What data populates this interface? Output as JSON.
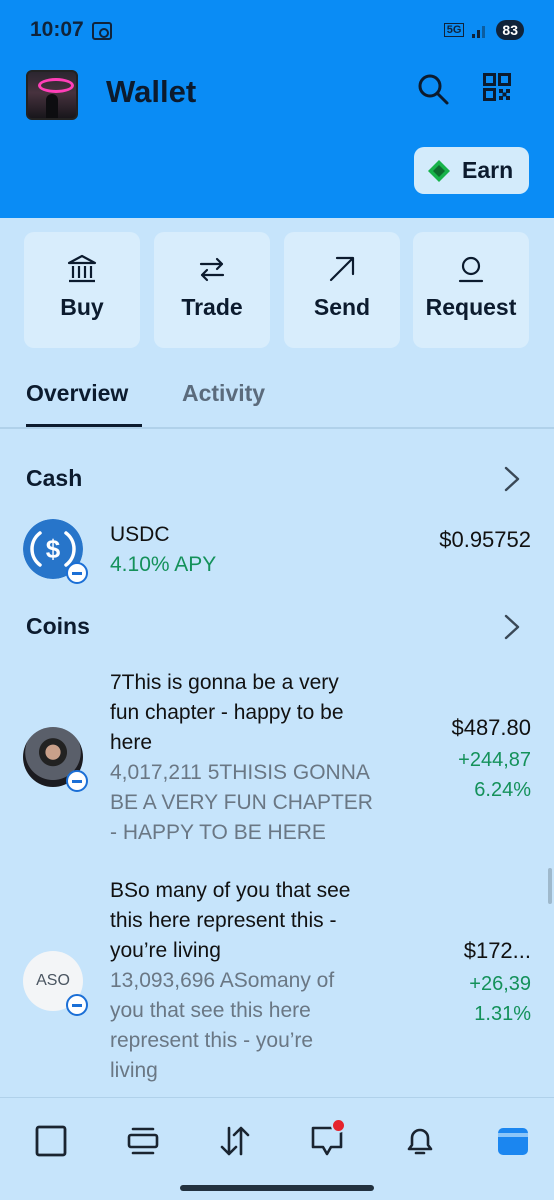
{
  "status_bar": {
    "time": "10:07",
    "network": "5G",
    "battery": "83",
    "icons": [
      "screen-record-icon",
      "signal-icon"
    ]
  },
  "header": {
    "title": "Wallet",
    "search_icon": "search-icon",
    "qr_icon": "qr-code-icon",
    "earn_label": "Earn"
  },
  "actions": [
    {
      "label": "Buy",
      "icon": "bank-icon"
    },
    {
      "label": "Trade",
      "icon": "swap-arrows-icon"
    },
    {
      "label": "Send",
      "icon": "arrow-up-right-icon"
    },
    {
      "label": "Request",
      "icon": "person-icon"
    }
  ],
  "tabs": [
    {
      "label": "Overview",
      "selected": true
    },
    {
      "label": "Activity",
      "selected": false
    }
  ],
  "cash": {
    "title": "Cash",
    "items": [
      {
        "name": "USDC",
        "apy": "4.10% APY",
        "value": "$0.95752",
        "icon": "usdc-icon"
      }
    ]
  },
  "coins": {
    "title": "Coins",
    "items": [
      {
        "name_lines": [
          "7This is gonna be a very",
          "fun chapter - happy to be",
          "here"
        ],
        "sub_lines": [
          "4,017,211 5THISIS GONNA",
          "BE A VERY FUN CHAPTER",
          "- HAPPY TO BE HERE"
        ],
        "price": "$487.80",
        "change_lines": [
          "+244,87",
          "6.24%"
        ]
      },
      {
        "icon_text": "ASO",
        "name_lines": [
          "BSo many of you that see",
          "this here represent this -",
          "you’re living"
        ],
        "sub_lines": [
          "13,093,696 ASomany of",
          "you that see this here",
          "represent this - you’re",
          "living"
        ],
        "price": "$172...",
        "change_lines": [
          "+26,39",
          "1.31%"
        ]
      }
    ]
  },
  "bottom_nav": [
    "home-square-icon",
    "feed-icon",
    "trade-arrows-icon",
    "chat-icon",
    "bell-icon",
    "wallet-icon"
  ],
  "colors": {
    "header_blue": "#0a8cf5",
    "page_bg": "#c6e4fb",
    "positive_green": "#14915a",
    "active_wallet_blue": "#1b86f0",
    "notification_red": "#e5232d"
  }
}
